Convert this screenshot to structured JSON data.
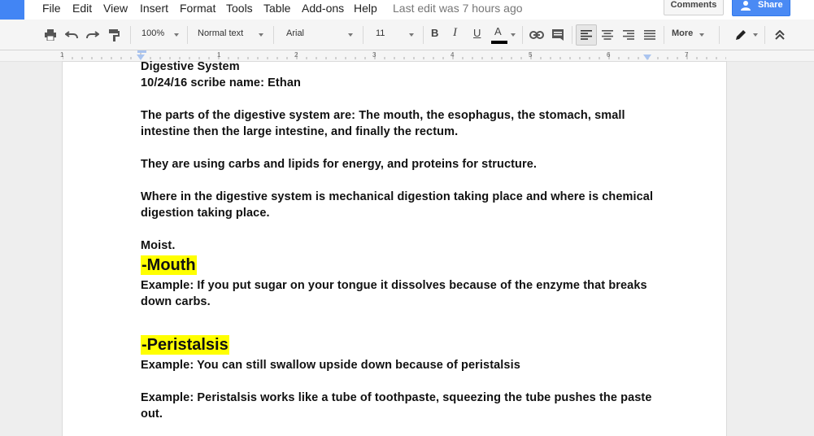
{
  "menu": {
    "items": [
      "File",
      "Edit",
      "View",
      "Insert",
      "Format",
      "Tools",
      "Table",
      "Add-ons",
      "Help"
    ],
    "last_edit": "Last edit was 7 hours ago",
    "comments_label": "Comments",
    "share_label": "Share"
  },
  "toolbar": {
    "zoom": "100%",
    "style": "Normal text",
    "font": "Arial",
    "size": "11",
    "bold": "B",
    "italic": "I",
    "underline": "U",
    "text_color": "A",
    "more": "More"
  },
  "ruler": {
    "numbers": [
      "1",
      "1",
      "2",
      "3",
      "4",
      "5",
      "6",
      "7"
    ]
  },
  "document": {
    "title": "Digestive System",
    "subtitle": "10/24/16 scribe name: Ethan",
    "p1_line1": "The parts of the digestive system are: The mouth, the esophagus, the stomach, small",
    "p1_line2": "intestine then the large intestine, and finally the rectum.",
    "p2": "They are using carbs and lipids for energy, and proteins for structure.",
    "p3_line1": "Where in the digestive system is mechanical digestion taking place and where is chemical",
    "p3_line2": "digestion taking place.",
    "moist": "Moist.",
    "heading_mouth": "-Mouth",
    "mouth_ex_line1": "Example: If you put sugar on your tongue it dissolves because of the enzyme that breaks",
    "mouth_ex_line2": "down carbs.",
    "heading_peristalsis": "-Peristalsis",
    "peri_ex1": "Example: You can still swallow upside down because of peristalsis",
    "peri_ex2_line1": "Example: Peristalsis works like a tube of toothpaste, squeezing the tube pushes the paste",
    "peri_ex2_line2": "out."
  },
  "colors": {
    "accent": "#4285f4",
    "highlight": "#ffff00"
  }
}
